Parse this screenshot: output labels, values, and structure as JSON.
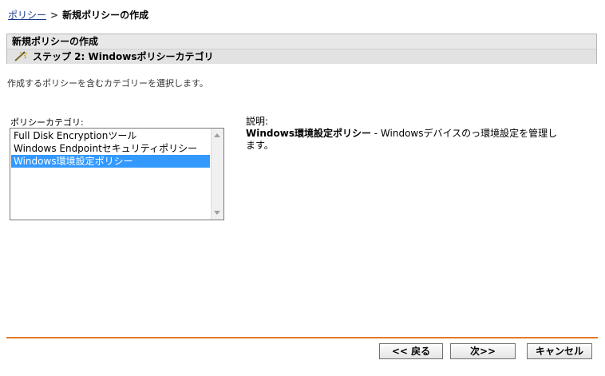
{
  "breadcrumb": {
    "link": "ポリシー",
    "separator": ">",
    "current": "新規ポリシーの作成"
  },
  "panel": {
    "title": "新規ポリシーの作成",
    "step": "ステップ 2: Windowsポリシーカテゴリ",
    "step_icon": "wizard-wand-icon"
  },
  "intro_text": "作成するポリシーを含むカテゴリーを選択します。",
  "category_list": {
    "label": "ポリシーカテゴリ:",
    "items": [
      {
        "label": "Full Disk Encryptionツール",
        "selected": false
      },
      {
        "label": "Windows Endpointセキュリティポリシー",
        "selected": false
      },
      {
        "label": "Windows環境設定ポリシー",
        "selected": true
      }
    ]
  },
  "description": {
    "label": "説明:",
    "policy_name": "Windows環境設定ポリシー",
    "text": " - Windowsデバイスのっ環境設定を管理します。"
  },
  "buttons": {
    "back": "<< 戻る",
    "next": "次>>",
    "cancel": "キャンセル"
  },
  "colors": {
    "selection": "#3399ff",
    "footer_rule": "#e07a2f",
    "link": "#1a3a8a"
  }
}
